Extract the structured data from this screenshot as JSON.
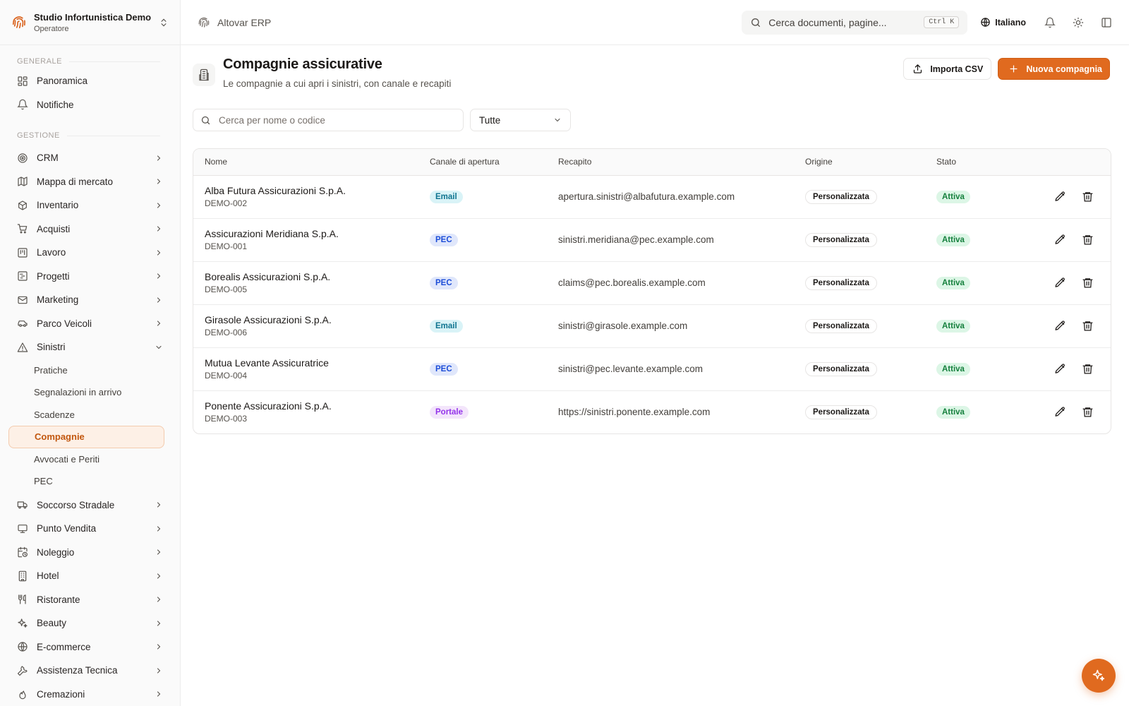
{
  "org": {
    "name": "Studio Infortunistica Demo",
    "role": "Operatore"
  },
  "sidebar": {
    "sections": [
      {
        "label": "GENERALE"
      },
      {
        "label": "GESTIONE"
      }
    ],
    "general": [
      "Panoramica",
      "Notifiche"
    ],
    "management": [
      "CRM",
      "Mappa di mercato",
      "Inventario",
      "Acquisti",
      "Lavoro",
      "Progetti",
      "Marketing",
      "Parco Veicoli",
      "Sinistri"
    ],
    "sinistri_sub": [
      "Pratiche",
      "Segnalazioni in arrivo",
      "Scadenze",
      "Compagnie",
      "Avvocati e Periti",
      "PEC"
    ],
    "more": [
      "Soccorso Stradale",
      "Punto Vendita",
      "Noleggio",
      "Hotel",
      "Ristorante",
      "Beauty",
      "E-commerce",
      "Assistenza Tecnica",
      "Cremazioni"
    ]
  },
  "topbar": {
    "brand": "Altovar ERP",
    "search_placeholder": "Cerca documenti, pagine...",
    "shortcut": "Ctrl K",
    "language": "Italiano"
  },
  "page": {
    "title": "Compagnie assicurative",
    "subtitle": "Le compagnie a cui apri i sinistri, con canale e recapiti",
    "import_label": "Importa CSV",
    "new_label": "Nuova compagnia",
    "filter_placeholder": "Cerca per nome o codice",
    "filter_select": "Tutte"
  },
  "table": {
    "columns": [
      "Nome",
      "Canale di apertura",
      "Recapito",
      "Origine",
      "Stato"
    ],
    "rows": [
      {
        "name": "Alba Futura Assicurazioni S.p.A.",
        "code": "DEMO-002",
        "channel": "Email",
        "contact": "apertura.sinistri@albafutura.example.com",
        "origin": "Personalizzata",
        "status": "Attiva"
      },
      {
        "name": "Assicurazioni Meridiana S.p.A.",
        "code": "DEMO-001",
        "channel": "PEC",
        "contact": "sinistri.meridiana@pec.example.com",
        "origin": "Personalizzata",
        "status": "Attiva"
      },
      {
        "name": "Borealis Assicurazioni S.p.A.",
        "code": "DEMO-005",
        "channel": "PEC",
        "contact": "claims@pec.borealis.example.com",
        "origin": "Personalizzata",
        "status": "Attiva"
      },
      {
        "name": "Girasole Assicurazioni S.p.A.",
        "code": "DEMO-006",
        "channel": "Email",
        "contact": "sinistri@girasole.example.com",
        "origin": "Personalizzata",
        "status": "Attiva"
      },
      {
        "name": "Mutua Levante Assicuratrice",
        "code": "DEMO-004",
        "channel": "PEC",
        "contact": "sinistri@pec.levante.example.com",
        "origin": "Personalizzata",
        "status": "Attiva"
      },
      {
        "name": "Ponente Assicurazioni S.p.A.",
        "code": "DEMO-003",
        "channel": "Portale",
        "contact": "https://sinistri.ponente.example.com",
        "origin": "Personalizzata",
        "status": "Attiva"
      }
    ]
  },
  "colors": {
    "accent": "#e06a1f",
    "active_bg": "#fdf0e6",
    "active_text": "#c2570f"
  }
}
